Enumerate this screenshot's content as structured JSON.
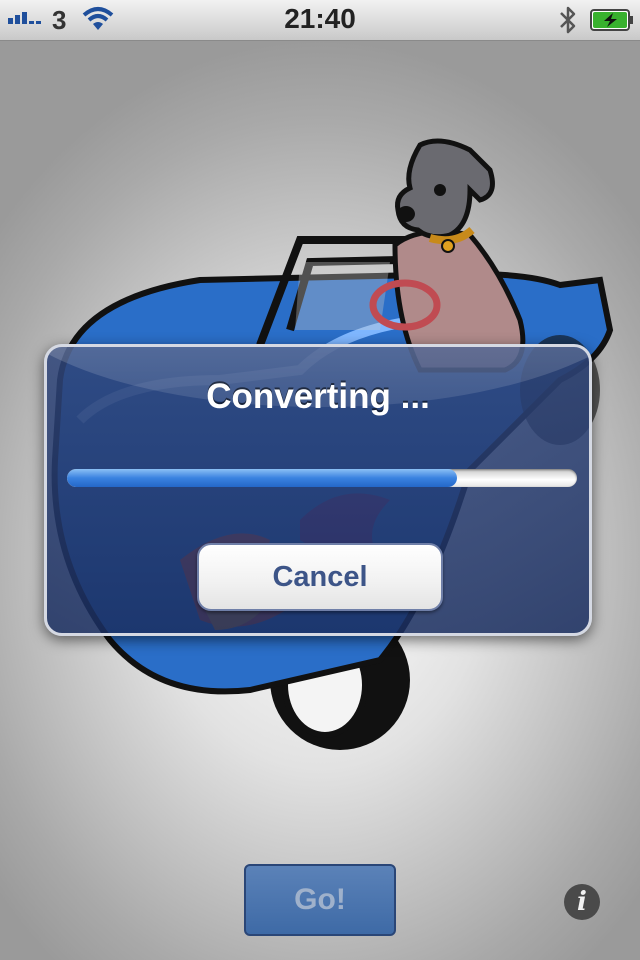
{
  "status_bar": {
    "carrier": "3",
    "time": "21:40"
  },
  "alert": {
    "title": "Converting ...",
    "progress": 0.765,
    "cancel_label": "Cancel"
  },
  "go_button_label": "Go!",
  "info_button_glyph": "i",
  "colors": {
    "alert_background": "#2a4478",
    "progress_fill": "#3a82e0",
    "cancel_text": "#3d5588",
    "go_button": "#4a74ae"
  },
  "icons": [
    "signal-strength-icon",
    "wifi-icon",
    "bluetooth-icon",
    "battery-charging-icon",
    "info-icon"
  ]
}
